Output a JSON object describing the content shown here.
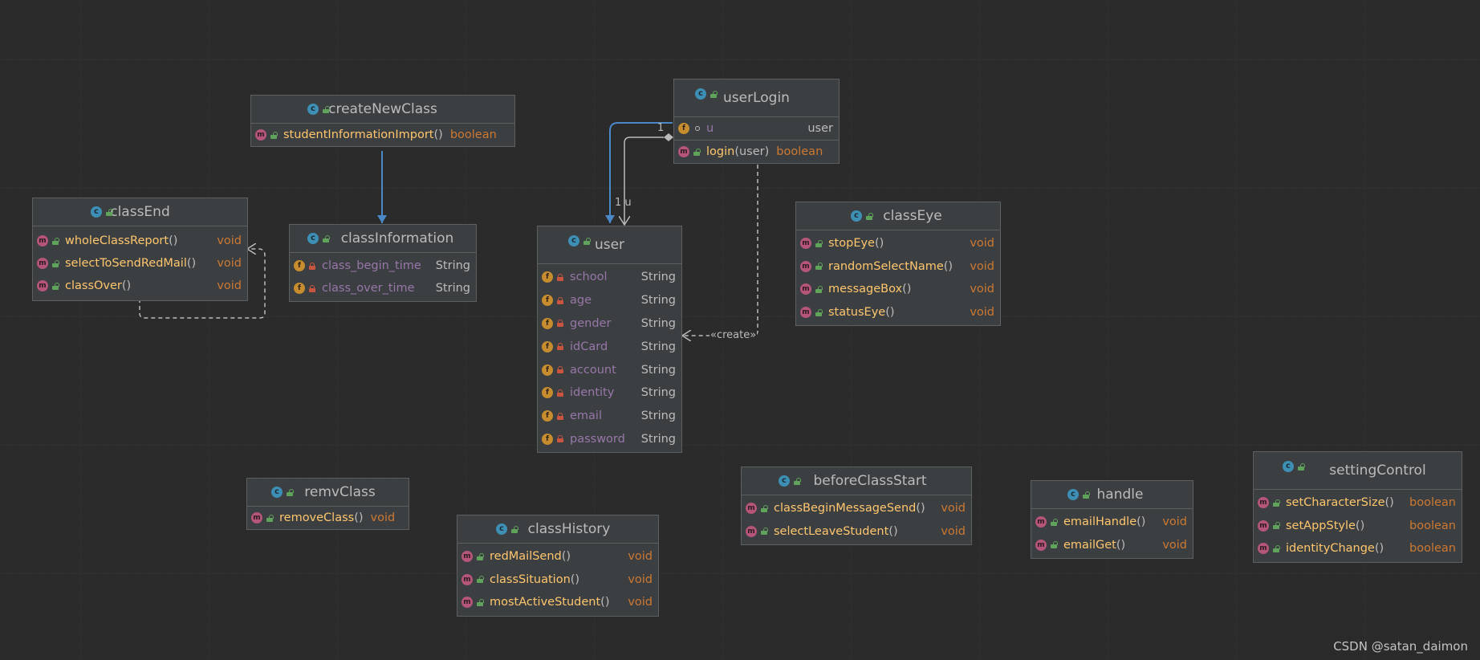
{
  "classes": {
    "userLogin": {
      "name": "userLogin",
      "fields": [
        {
          "name": "u",
          "type": "user"
        }
      ],
      "methods": [
        {
          "name": "login",
          "params": "(user)",
          "type": "boolean"
        }
      ]
    },
    "createNewClass": {
      "name": "createNewClass",
      "methods": [
        {
          "name": "studentInformationImport",
          "params": "()",
          "type": "boolean"
        }
      ]
    },
    "classEnd": {
      "name": "classEnd",
      "methods": [
        {
          "name": "wholeClassReport",
          "params": "()",
          "type": "void"
        },
        {
          "name": "selectToSendRedMail",
          "params": "()",
          "type": "void"
        },
        {
          "name": "classOver",
          "params": "()",
          "type": "void"
        }
      ]
    },
    "classInformation": {
      "name": "classInformation",
      "fields": [
        {
          "name": "class_begin_time",
          "type": "String"
        },
        {
          "name": "class_over_time",
          "type": "String"
        }
      ]
    },
    "user": {
      "name": "user",
      "fields": [
        {
          "name": "school",
          "type": "String"
        },
        {
          "name": "age",
          "type": "String"
        },
        {
          "name": "gender",
          "type": "String"
        },
        {
          "name": "idCard",
          "type": "String"
        },
        {
          "name": "account",
          "type": "String"
        },
        {
          "name": "identity",
          "type": "String"
        },
        {
          "name": "email",
          "type": "String"
        },
        {
          "name": "password",
          "type": "String"
        }
      ]
    },
    "classEye": {
      "name": "classEye",
      "methods": [
        {
          "name": "stopEye",
          "params": "()",
          "type": "void"
        },
        {
          "name": "randomSelectName",
          "params": "()",
          "type": "void"
        },
        {
          "name": "messageBox",
          "params": "()",
          "type": "void"
        },
        {
          "name": "statusEye",
          "params": "()",
          "type": "void"
        }
      ]
    },
    "remvClass": {
      "name": "remvClass",
      "methods": [
        {
          "name": "removeClass",
          "params": "()",
          "type": "void"
        }
      ]
    },
    "classHistory": {
      "name": "classHistory",
      "methods": [
        {
          "name": "redMailSend",
          "params": "()",
          "type": "void"
        },
        {
          "name": "classSituation",
          "params": "()",
          "type": "void"
        },
        {
          "name": "mostActiveStudent",
          "params": "()",
          "type": "void"
        }
      ]
    },
    "beforeClassStart": {
      "name": "beforeClassStart",
      "methods": [
        {
          "name": "classBeginMessageSend",
          "params": "()",
          "type": "void"
        },
        {
          "name": "selectLeaveStudent",
          "params": "()",
          "type": "void"
        }
      ]
    },
    "handle": {
      "name": "handle",
      "methods": [
        {
          "name": "emailHandle",
          "params": "()",
          "type": "void"
        },
        {
          "name": "emailGet",
          "params": "()",
          "type": "void"
        }
      ]
    },
    "settingControl": {
      "name": "settingControl",
      "methods": [
        {
          "name": "setCharacterSize",
          "params": "()",
          "type": "boolean"
        },
        {
          "name": "setAppStyle",
          "params": "()",
          "type": "boolean"
        },
        {
          "name": "identityChange",
          "params": "()",
          "type": "boolean"
        }
      ]
    }
  },
  "edges": {
    "assoc_multiplicity": "1",
    "comp_label": "1 u",
    "create_label": "«create»"
  },
  "watermark": "CSDN @satan_daimon",
  "icons": {
    "class": "class-icon",
    "method": "method-icon",
    "field": "field-icon",
    "public": "public-visibility-icon",
    "private": "private-visibility-icon",
    "package": "package-visibility-icon"
  },
  "colors": {
    "background": "#2b2b2b",
    "box": "#3c3f41",
    "method_name": "#ffc66d",
    "field_name": "#9876aa",
    "return_type": "#cc7832",
    "arrow_blue": "#4a88c7"
  }
}
